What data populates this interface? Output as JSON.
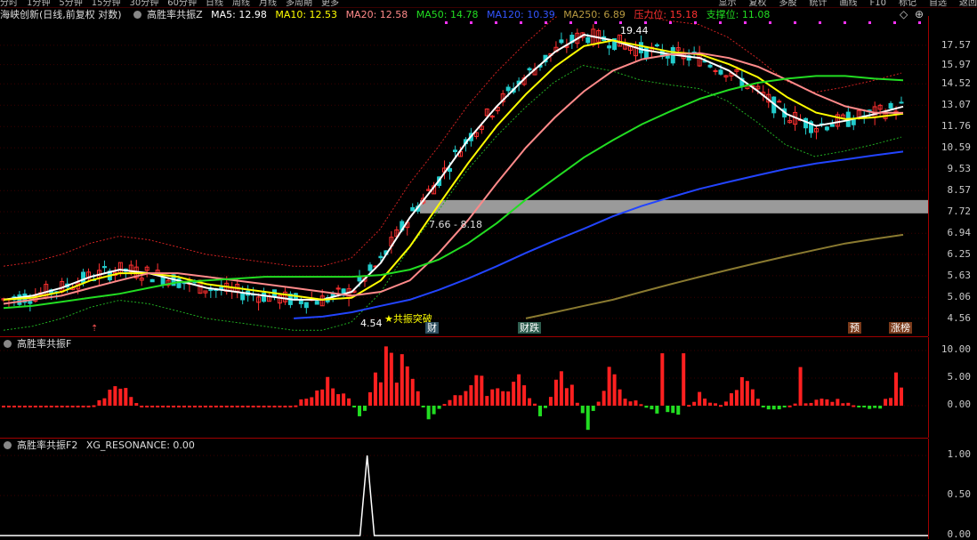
{
  "menu": {
    "tabs": [
      "分时",
      "1分钟",
      "5分钟",
      "15分钟",
      "30分钟",
      "60分钟",
      "日线",
      "周线",
      "月线",
      "多周期",
      "更多"
    ],
    "right": [
      "显示",
      "复权",
      "多股",
      "统计",
      "画线",
      "F10",
      "标记",
      "自选",
      "返回"
    ]
  },
  "main_header": {
    "stock_info": "海峡创新(日线,前复权 对数)",
    "indicator": "高胜率共振Z",
    "ma5": "MA5: 12.98",
    "ma10": "MA10: 12.53",
    "ma20": "MA20: 12.58",
    "ma50": "MA50: 14.78",
    "ma120": "MA120: 10.39",
    "ma250": "MA250: 6.89",
    "pressure": "压力位: 15.18",
    "support": "支撑位: 11.08"
  },
  "annotations": {
    "high": "19.44",
    "low": "4.54",
    "mid": "7.66 - 8.18",
    "resonance": "共振突破",
    "cai": "财",
    "cai_die": "财跌",
    "yu": "预",
    "zhang": "涨榜"
  },
  "panel2": {
    "title": "高胜率共振F"
  },
  "panel3": {
    "title": "高胜率共振F2",
    "value": "XG_RESONANCE: 0.00"
  },
  "axis_main": [
    "17.57",
    "15.97",
    "14.52",
    "13.07",
    "11.76",
    "10.59",
    "9.53",
    "8.57",
    "7.72",
    "6.94",
    "6.25",
    "5.63",
    "5.06",
    "4.56"
  ],
  "axis_sub": [
    "10.00",
    "5.00",
    "0.00"
  ],
  "axis_res": [
    "1.00",
    "0.50",
    "0.00"
  ],
  "chart_data": {
    "type": "line",
    "series": [
      {
        "name": "MA5",
        "values": [
          5.0,
          5.1,
          5.3,
          5.6,
          5.8,
          5.7,
          5.5,
          5.3,
          5.2,
          5.1,
          5.0,
          5.0,
          5.2,
          6.0,
          7.5,
          9.0,
          11.0,
          13.0,
          15.0,
          17.0,
          18.5,
          18.0,
          17.2,
          16.8,
          16.5,
          15.5,
          14.0,
          12.5,
          11.8,
          12.1,
          12.5,
          12.98
        ]
      },
      {
        "name": "MA10",
        "values": [
          5.0,
          5.05,
          5.2,
          5.5,
          5.7,
          5.7,
          5.6,
          5.4,
          5.3,
          5.2,
          5.1,
          5.0,
          5.05,
          5.5,
          6.5,
          8.0,
          9.8,
          11.8,
          13.8,
          15.8,
          17.5,
          18.0,
          17.5,
          17.0,
          16.8,
          16.0,
          15.0,
          13.6,
          12.6,
          12.2,
          12.3,
          12.53
        ]
      },
      {
        "name": "MA20",
        "values": [
          4.9,
          5.0,
          5.1,
          5.3,
          5.5,
          5.7,
          5.7,
          5.6,
          5.5,
          5.4,
          5.3,
          5.2,
          5.1,
          5.2,
          5.5,
          6.3,
          7.4,
          8.9,
          10.6,
          12.3,
          14.0,
          15.5,
          16.4,
          16.8,
          16.9,
          16.5,
          15.8,
          14.8,
          13.8,
          13.0,
          12.6,
          12.58
        ]
      },
      {
        "name": "MA50",
        "values": [
          4.8,
          4.85,
          4.95,
          5.05,
          5.15,
          5.3,
          5.45,
          5.5,
          5.55,
          5.6,
          5.6,
          5.6,
          5.6,
          5.65,
          5.8,
          6.1,
          6.6,
          7.3,
          8.2,
          9.1,
          10.1,
          11.0,
          11.9,
          12.7,
          13.5,
          14.1,
          14.6,
          14.9,
          15.1,
          15.1,
          14.9,
          14.78
        ]
      },
      {
        "name": "MA120",
        "values": [
          null,
          null,
          null,
          null,
          null,
          null,
          null,
          null,
          null,
          null,
          4.56,
          4.6,
          4.7,
          4.85,
          5.0,
          5.25,
          5.55,
          5.9,
          6.3,
          6.7,
          7.1,
          7.55,
          7.95,
          8.3,
          8.65,
          8.95,
          9.25,
          9.55,
          9.8,
          10.0,
          10.2,
          10.39
        ]
      },
      {
        "name": "MA250",
        "values": [
          null,
          null,
          null,
          null,
          null,
          null,
          null,
          null,
          null,
          null,
          null,
          null,
          null,
          null,
          null,
          null,
          null,
          null,
          4.56,
          4.7,
          4.85,
          5.0,
          5.2,
          5.4,
          5.6,
          5.8,
          6.0,
          6.2,
          6.4,
          6.6,
          6.75,
          6.89
        ]
      }
    ],
    "osc": [
      0,
      0,
      0,
      0,
      0,
      4,
      0,
      0,
      0,
      0,
      0,
      0,
      0,
      0,
      4,
      3,
      -2,
      9,
      6,
      -3,
      2,
      4,
      3,
      5,
      -2,
      7,
      -4,
      5,
      1,
      -1,
      -2,
      2,
      0,
      4,
      -1,
      0,
      1,
      1,
      0,
      -1,
      6
    ],
    "resonance_signal_index": 0.405
  }
}
